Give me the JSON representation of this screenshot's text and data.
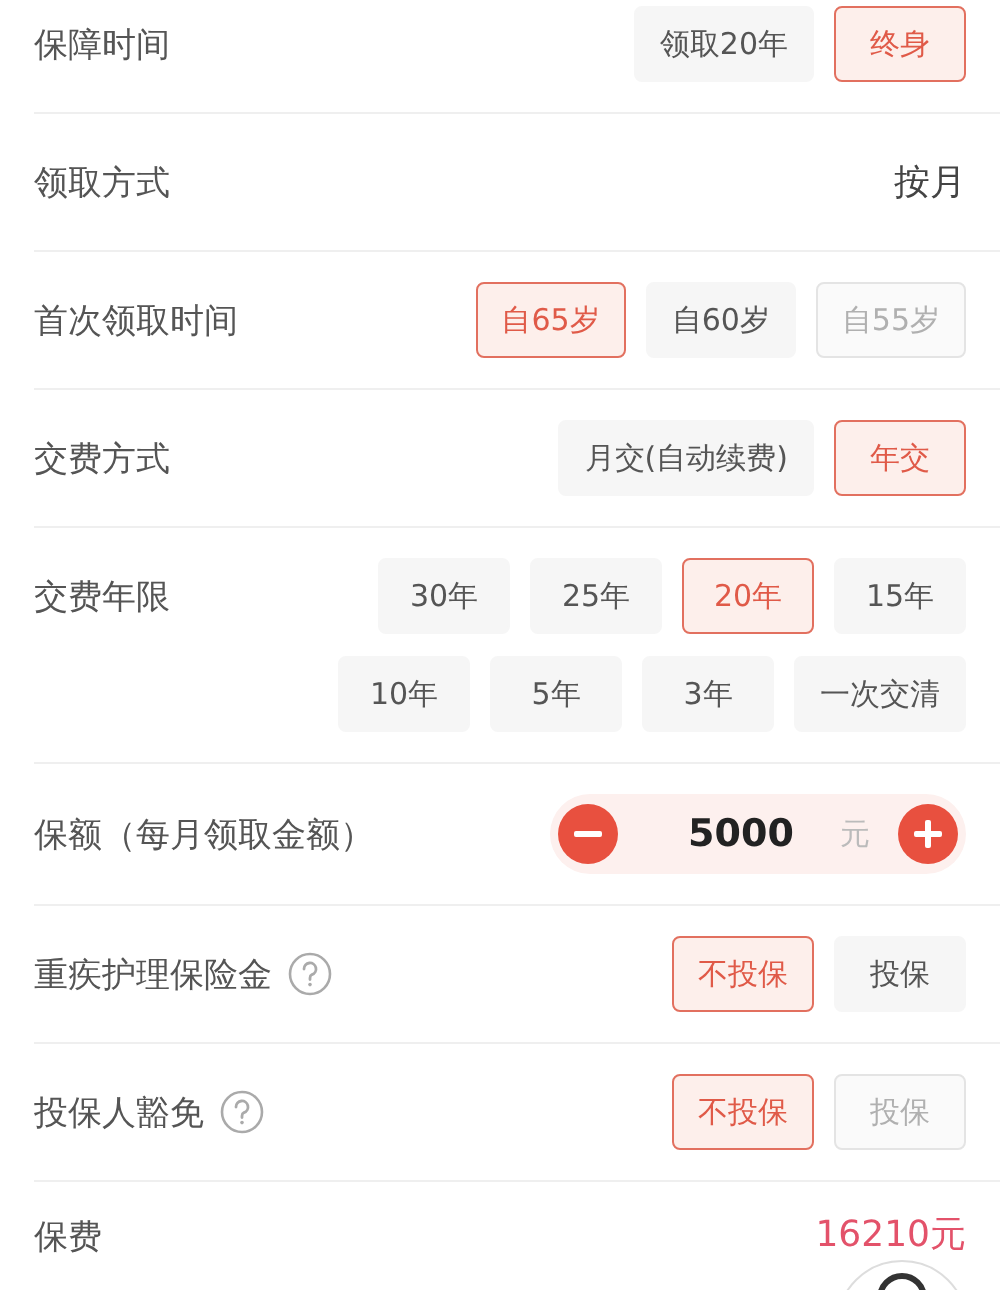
{
  "rows": [
    {
      "kind": "options",
      "label": "保障时间",
      "options": [
        {
          "label": "领取20年",
          "selected": false,
          "disabled": false
        },
        {
          "label": "终身",
          "selected": true,
          "disabled": false
        }
      ]
    },
    {
      "kind": "value",
      "label": "领取方式",
      "value": "按月",
      "emphasis": false
    },
    {
      "kind": "options",
      "label": "首次领取时间",
      "options": [
        {
          "label": "自65岁",
          "selected": true,
          "disabled": false
        },
        {
          "label": "自60岁",
          "selected": false,
          "disabled": false
        },
        {
          "label": "自55岁",
          "selected": false,
          "disabled": true
        }
      ]
    },
    {
      "kind": "options",
      "label": "交费方式",
      "options": [
        {
          "label": "月交(自动续费)",
          "selected": false,
          "disabled": false
        },
        {
          "label": "年交",
          "selected": true,
          "disabled": false
        }
      ]
    },
    {
      "kind": "options",
      "label": "交费年限",
      "options": [
        {
          "label": "30年",
          "selected": false,
          "disabled": false
        },
        {
          "label": "25年",
          "selected": false,
          "disabled": false
        },
        {
          "label": "20年",
          "selected": true,
          "disabled": false
        },
        {
          "label": "15年",
          "selected": false,
          "disabled": false
        },
        {
          "label": "10年",
          "selected": false,
          "disabled": false
        },
        {
          "label": "5年",
          "selected": false,
          "disabled": false
        },
        {
          "label": "3年",
          "selected": false,
          "disabled": false
        },
        {
          "label": "一次交清",
          "selected": false,
          "disabled": false
        }
      ]
    },
    {
      "kind": "stepper",
      "label": "保额（每月领取金额）",
      "amount": "5000",
      "unit": "元"
    },
    {
      "kind": "options",
      "label": "重疾护理保险金",
      "help": true,
      "options": [
        {
          "label": "不投保",
          "selected": true,
          "disabled": false
        },
        {
          "label": "投保",
          "selected": false,
          "disabled": false
        }
      ]
    },
    {
      "kind": "options",
      "label": "投保人豁免",
      "help": true,
      "options": [
        {
          "label": "不投保",
          "selected": true,
          "disabled": false
        },
        {
          "label": "投保",
          "selected": false,
          "disabled": true
        }
      ]
    },
    {
      "kind": "value",
      "label": "保费",
      "value": "16210元",
      "emphasis": true
    }
  ]
}
